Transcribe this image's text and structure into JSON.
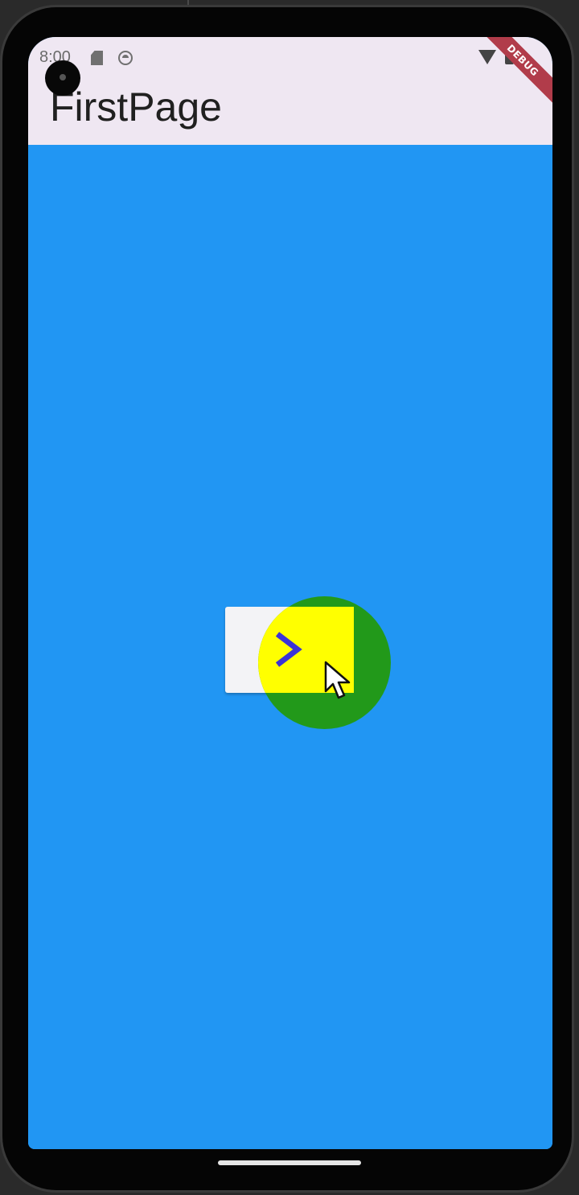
{
  "status_bar": {
    "time": "8:00",
    "debug_banner": "DEBUG"
  },
  "app_bar": {
    "title": "FirstPage"
  },
  "colors": {
    "app_bar_background": "#efe7f2",
    "page_background": "#2196f3",
    "ripple": "#22991a",
    "highlight": "#ffff00",
    "chevron": "#3b33d6",
    "debug_banner": "#b13c4a"
  },
  "icons": {
    "next": "chevron-right-icon",
    "pointer": "mouse-cursor-icon"
  }
}
